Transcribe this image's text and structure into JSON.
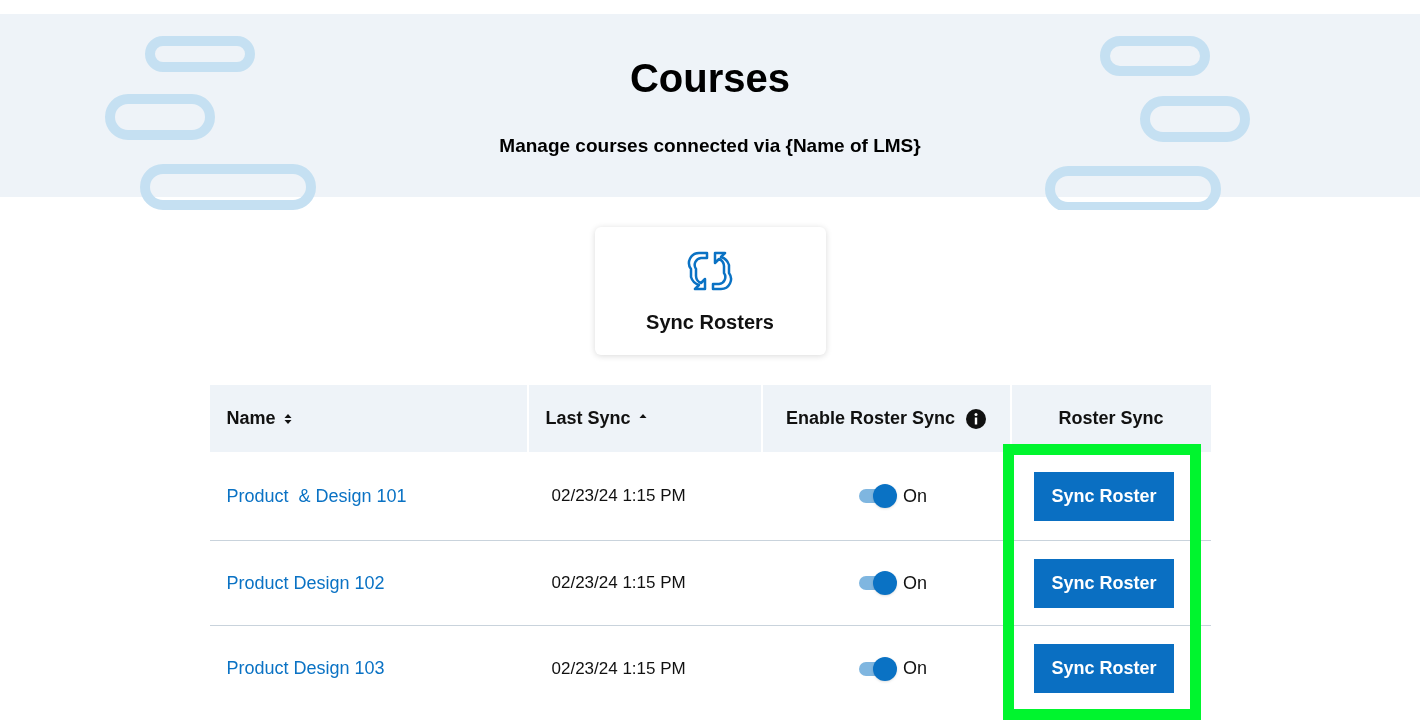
{
  "header": {
    "title": "Courses",
    "subtitle": "Manage courses connected via {Name of LMS}"
  },
  "action_card": {
    "label": "Sync Rosters"
  },
  "table": {
    "columns": [
      {
        "label": "Name",
        "sortable": true,
        "sorted": false,
        "info": false
      },
      {
        "label": "Last Sync",
        "sortable": true,
        "sorted": true,
        "info": false
      },
      {
        "label": "Enable Roster Sync",
        "sortable": false,
        "info": true
      },
      {
        "label": "Roster Sync",
        "sortable": false,
        "info": false
      }
    ],
    "rows": [
      {
        "name": "Product  & Design 101",
        "last_sync": "02/23/24 1:15 PM",
        "sync_enabled": true,
        "toggle_label": "On",
        "button": "Sync Roster"
      },
      {
        "name": "Product Design 102",
        "last_sync": "02/23/24 1:15 PM",
        "sync_enabled": true,
        "toggle_label": "On",
        "button": "Sync Roster"
      },
      {
        "name": "Product Design 103",
        "last_sync": "02/23/24 1:15 PM",
        "sync_enabled": true,
        "toggle_label": "On",
        "button": "Sync Roster"
      }
    ],
    "highlight_roster_sync": true
  }
}
